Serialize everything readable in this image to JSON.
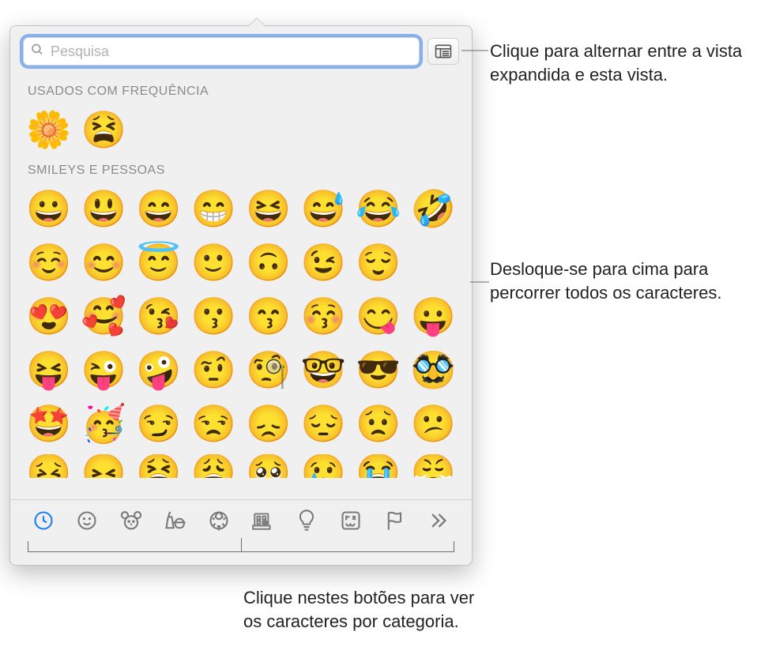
{
  "search": {
    "placeholder": "Pesquisa"
  },
  "sections": {
    "frequent": {
      "header": "USADOS COM FREQUÊNCIA",
      "emojis": [
        "🌼",
        "😫"
      ]
    },
    "smileys": {
      "header": "SMILEYS E PESSOAS",
      "rows": [
        [
          "😀",
          "😃",
          "😄",
          "😁",
          "😆",
          "😅",
          "😂",
          "🤣"
        ],
        [
          "☺️",
          "😊",
          "😇",
          "🙂",
          "🙃",
          "😉",
          "😌"
        ],
        [
          "😍",
          "🥰",
          "😘",
          "😗",
          "😙",
          "😚",
          "😋",
          "😛"
        ],
        [
          "😝",
          "😜",
          "🤪",
          "🤨",
          "🧐",
          "🤓",
          "😎",
          "🥸"
        ],
        [
          "🤩",
          "🥳",
          "😏",
          "😒",
          "😞",
          "😔",
          "😟",
          "😕"
        ],
        [
          "😣",
          "😖",
          "😫",
          "😩",
          "🥺",
          "😢",
          "😭",
          "😤"
        ]
      ]
    }
  },
  "categories": [
    {
      "id": "recent",
      "active": true
    },
    {
      "id": "smileys",
      "active": false
    },
    {
      "id": "animals",
      "active": false
    },
    {
      "id": "food",
      "active": false
    },
    {
      "id": "activity",
      "active": false
    },
    {
      "id": "travel",
      "active": false
    },
    {
      "id": "objects",
      "active": false
    },
    {
      "id": "symbols",
      "active": false
    },
    {
      "id": "flags",
      "active": false
    },
    {
      "id": "more",
      "active": false
    }
  ],
  "callouts": {
    "expand": "Clique para alternar entre a vista expandida e esta vista.",
    "scroll": "Desloque-se para cima para percorrer todos os caracteres.",
    "categories": "Clique nestes botões para ver os caracteres por categoria."
  }
}
